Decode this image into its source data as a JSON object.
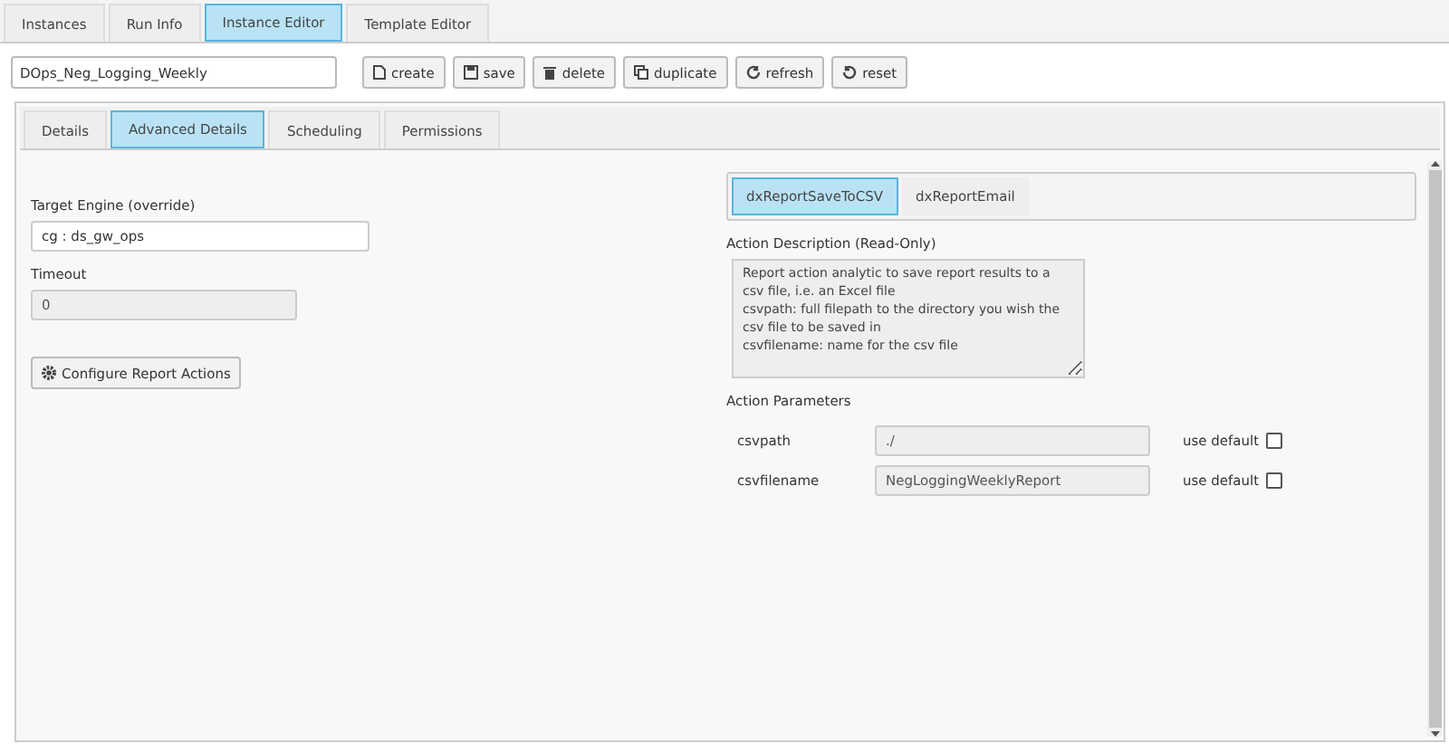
{
  "main_tabs": [
    {
      "label": "Instances",
      "selected": false
    },
    {
      "label": "Run Info",
      "selected": false
    },
    {
      "label": "Instance Editor",
      "selected": true
    },
    {
      "label": "Template Editor",
      "selected": false
    }
  ],
  "instance_name": {
    "value": "DOps_Neg_Logging_Weekly"
  },
  "toolbar": [
    {
      "label": "create",
      "kind": "file"
    },
    {
      "label": "save",
      "kind": "disk"
    },
    {
      "label": "delete",
      "kind": "trash"
    },
    {
      "label": "duplicate",
      "kind": "copy"
    },
    {
      "label": "refresh",
      "kind": "refresh"
    },
    {
      "label": "reset",
      "kind": "undo"
    }
  ],
  "editor_tabs": [
    {
      "label": "Details",
      "selected": false
    },
    {
      "label": "Advanced Details",
      "selected": true
    },
    {
      "label": "Scheduling",
      "selected": false
    },
    {
      "label": "Permissions",
      "selected": false
    }
  ],
  "target_engine": {
    "label": "Target Engine (override)",
    "value": "cg : ds_gw_ops"
  },
  "timeout": {
    "label": "Timeout",
    "value": "0",
    "disabled": true
  },
  "configure_button": {
    "label": "Configure Report Actions"
  },
  "action_tabs": [
    {
      "label": "dxReportSaveToCSV",
      "selected": true
    },
    {
      "label": "dxReportEmail",
      "selected": false
    }
  ],
  "action_description": {
    "label": "Action Description (Read-Only)",
    "value": "Report action analytic to save report results to a csv file, i.e. an Excel file\ncsvpath: full filepath to the directory you wish the csv file to be saved in\ncsvfilename: name for the csv file"
  },
  "action_parameters": {
    "label": "Action Parameters",
    "rows": [
      {
        "name": "csvpath",
        "value": "./",
        "default_label": "use default",
        "checked": false
      },
      {
        "name": "csvfilename",
        "value": "NegLoggingWeeklyReport",
        "default_label": "use default",
        "checked": false
      }
    ]
  }
}
